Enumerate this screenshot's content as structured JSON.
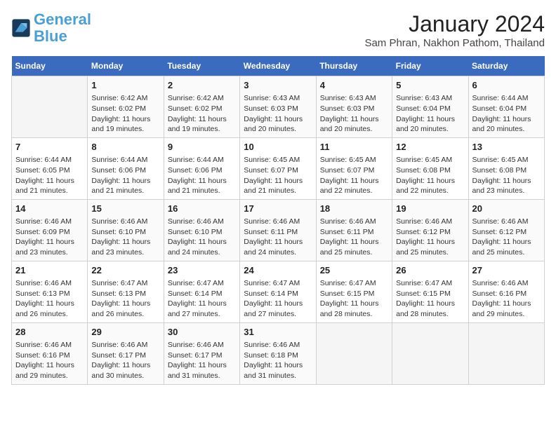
{
  "header": {
    "logo_line1": "General",
    "logo_line2": "Blue",
    "month_title": "January 2024",
    "location": "Sam Phran, Nakhon Pathom, Thailand"
  },
  "weekdays": [
    "Sunday",
    "Monday",
    "Tuesday",
    "Wednesday",
    "Thursday",
    "Friday",
    "Saturday"
  ],
  "weeks": [
    [
      {
        "day": "",
        "info": ""
      },
      {
        "day": "1",
        "info": "Sunrise: 6:42 AM\nSunset: 6:02 PM\nDaylight: 11 hours\nand 19 minutes."
      },
      {
        "day": "2",
        "info": "Sunrise: 6:42 AM\nSunset: 6:02 PM\nDaylight: 11 hours\nand 19 minutes."
      },
      {
        "day": "3",
        "info": "Sunrise: 6:43 AM\nSunset: 6:03 PM\nDaylight: 11 hours\nand 20 minutes."
      },
      {
        "day": "4",
        "info": "Sunrise: 6:43 AM\nSunset: 6:03 PM\nDaylight: 11 hours\nand 20 minutes."
      },
      {
        "day": "5",
        "info": "Sunrise: 6:43 AM\nSunset: 6:04 PM\nDaylight: 11 hours\nand 20 minutes."
      },
      {
        "day": "6",
        "info": "Sunrise: 6:44 AM\nSunset: 6:04 PM\nDaylight: 11 hours\nand 20 minutes."
      }
    ],
    [
      {
        "day": "7",
        "info": "Sunrise: 6:44 AM\nSunset: 6:05 PM\nDaylight: 11 hours\nand 21 minutes."
      },
      {
        "day": "8",
        "info": "Sunrise: 6:44 AM\nSunset: 6:06 PM\nDaylight: 11 hours\nand 21 minutes."
      },
      {
        "day": "9",
        "info": "Sunrise: 6:44 AM\nSunset: 6:06 PM\nDaylight: 11 hours\nand 21 minutes."
      },
      {
        "day": "10",
        "info": "Sunrise: 6:45 AM\nSunset: 6:07 PM\nDaylight: 11 hours\nand 21 minutes."
      },
      {
        "day": "11",
        "info": "Sunrise: 6:45 AM\nSunset: 6:07 PM\nDaylight: 11 hours\nand 22 minutes."
      },
      {
        "day": "12",
        "info": "Sunrise: 6:45 AM\nSunset: 6:08 PM\nDaylight: 11 hours\nand 22 minutes."
      },
      {
        "day": "13",
        "info": "Sunrise: 6:45 AM\nSunset: 6:08 PM\nDaylight: 11 hours\nand 23 minutes."
      }
    ],
    [
      {
        "day": "14",
        "info": "Sunrise: 6:46 AM\nSunset: 6:09 PM\nDaylight: 11 hours\nand 23 minutes."
      },
      {
        "day": "15",
        "info": "Sunrise: 6:46 AM\nSunset: 6:10 PM\nDaylight: 11 hours\nand 23 minutes."
      },
      {
        "day": "16",
        "info": "Sunrise: 6:46 AM\nSunset: 6:10 PM\nDaylight: 11 hours\nand 24 minutes."
      },
      {
        "day": "17",
        "info": "Sunrise: 6:46 AM\nSunset: 6:11 PM\nDaylight: 11 hours\nand 24 minutes."
      },
      {
        "day": "18",
        "info": "Sunrise: 6:46 AM\nSunset: 6:11 PM\nDaylight: 11 hours\nand 25 minutes."
      },
      {
        "day": "19",
        "info": "Sunrise: 6:46 AM\nSunset: 6:12 PM\nDaylight: 11 hours\nand 25 minutes."
      },
      {
        "day": "20",
        "info": "Sunrise: 6:46 AM\nSunset: 6:12 PM\nDaylight: 11 hours\nand 25 minutes."
      }
    ],
    [
      {
        "day": "21",
        "info": "Sunrise: 6:46 AM\nSunset: 6:13 PM\nDaylight: 11 hours\nand 26 minutes."
      },
      {
        "day": "22",
        "info": "Sunrise: 6:47 AM\nSunset: 6:13 PM\nDaylight: 11 hours\nand 26 minutes."
      },
      {
        "day": "23",
        "info": "Sunrise: 6:47 AM\nSunset: 6:14 PM\nDaylight: 11 hours\nand 27 minutes."
      },
      {
        "day": "24",
        "info": "Sunrise: 6:47 AM\nSunset: 6:14 PM\nDaylight: 11 hours\nand 27 minutes."
      },
      {
        "day": "25",
        "info": "Sunrise: 6:47 AM\nSunset: 6:15 PM\nDaylight: 11 hours\nand 28 minutes."
      },
      {
        "day": "26",
        "info": "Sunrise: 6:47 AM\nSunset: 6:15 PM\nDaylight: 11 hours\nand 28 minutes."
      },
      {
        "day": "27",
        "info": "Sunrise: 6:46 AM\nSunset: 6:16 PM\nDaylight: 11 hours\nand 29 minutes."
      }
    ],
    [
      {
        "day": "28",
        "info": "Sunrise: 6:46 AM\nSunset: 6:16 PM\nDaylight: 11 hours\nand 29 minutes."
      },
      {
        "day": "29",
        "info": "Sunrise: 6:46 AM\nSunset: 6:17 PM\nDaylight: 11 hours\nand 30 minutes."
      },
      {
        "day": "30",
        "info": "Sunrise: 6:46 AM\nSunset: 6:17 PM\nDaylight: 11 hours\nand 31 minutes."
      },
      {
        "day": "31",
        "info": "Sunrise: 6:46 AM\nSunset: 6:18 PM\nDaylight: 11 hours\nand 31 minutes."
      },
      {
        "day": "",
        "info": ""
      },
      {
        "day": "",
        "info": ""
      },
      {
        "day": "",
        "info": ""
      }
    ]
  ]
}
